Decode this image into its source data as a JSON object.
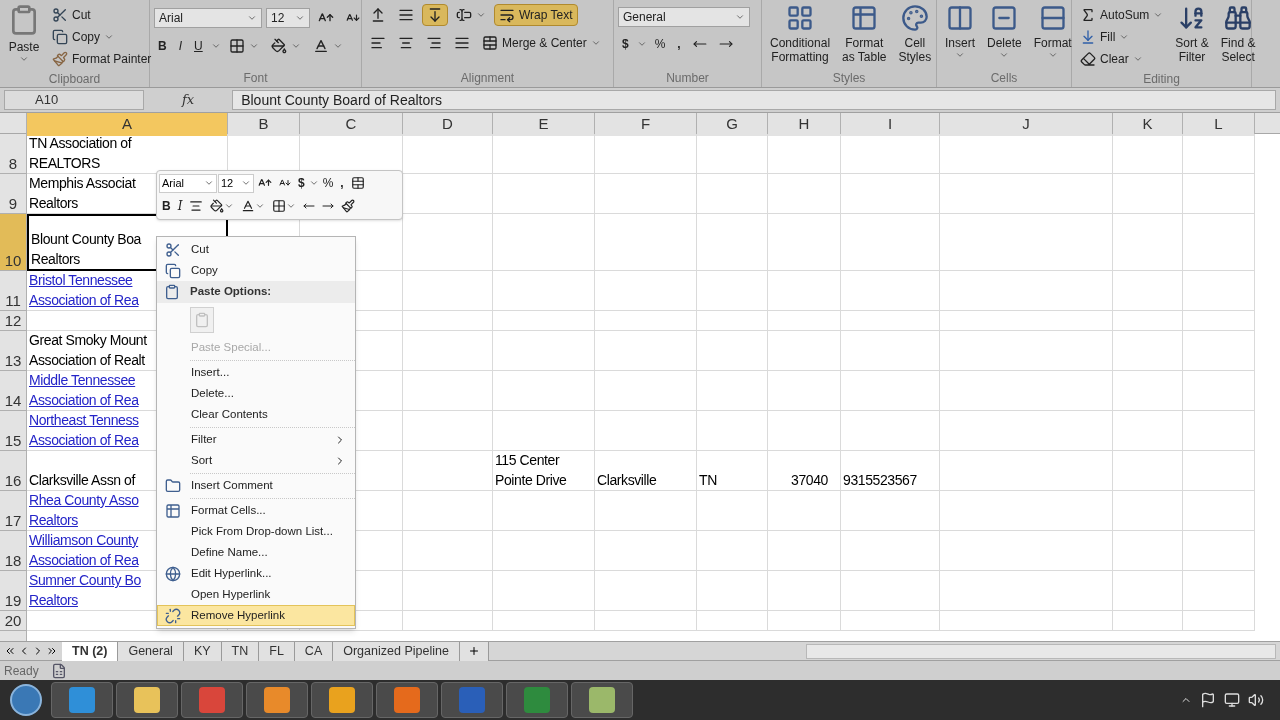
{
  "ribbon": {
    "clipboard": {
      "label": "Clipboard",
      "paste": "Paste",
      "cut": "Cut",
      "copy": "Copy",
      "format_painter": "Format Painter"
    },
    "font": {
      "label": "Font",
      "font_name": "Arial",
      "font_size": "12",
      "bold": "B",
      "italic": "I",
      "underline": "U"
    },
    "alignment": {
      "label": "Alignment",
      "bottom_align_on": true,
      "wrap_text": "Wrap Text",
      "wrap_text_on": true,
      "merge": "Merge & Center"
    },
    "number": {
      "label": "Number",
      "format": "General",
      "currency": "$",
      "percent": "%",
      "comma": ","
    },
    "styles": {
      "label": "Styles",
      "buttons": [
        "Conditional\nFormatting",
        "Format\nas Table",
        "Cell\nStyles"
      ]
    },
    "cells": {
      "label": "Cells",
      "buttons": [
        "Insert",
        "Delete",
        "Format"
      ]
    },
    "editing": {
      "label": "Editing",
      "autosum": "AutoSum",
      "fill": "Fill",
      "clear": "Clear",
      "buttons": [
        "Sort &\nFilter",
        "Find &\nSelect"
      ]
    }
  },
  "formula_bar": {
    "name_box": "A10",
    "fx": "fx",
    "value": "Blount County Board of Realtors"
  },
  "columns": [
    {
      "label": "A",
      "selected": true
    },
    {
      "label": "B",
      "selected": false
    },
    {
      "label": "C",
      "selected": false
    },
    {
      "label": "D",
      "selected": false
    },
    {
      "label": "E",
      "selected": false
    },
    {
      "label": "F",
      "selected": false
    },
    {
      "label": "G",
      "selected": false
    },
    {
      "label": "H",
      "selected": false
    },
    {
      "label": "I",
      "selected": false
    },
    {
      "label": "J",
      "selected": false
    },
    {
      "label": "K",
      "selected": false
    },
    {
      "label": "L",
      "selected": false
    }
  ],
  "rows": [
    {
      "header": "8",
      "selected": false,
      "cells": [
        {
          "kind": "text",
          "text": "TN Association of\nREALTORS"
        }
      ]
    },
    {
      "header": "9",
      "selected": false,
      "cells": [
        {
          "kind": "text",
          "text": "Memphis Associat\nRealtors"
        }
      ]
    },
    {
      "header": "10",
      "selected": true,
      "cells": [
        {
          "kind": "text",
          "text": "Blount County Boa\nRealtors"
        }
      ]
    },
    {
      "header": "11",
      "selected": false,
      "cells": [
        {
          "kind": "link",
          "text": "Bristol Tennessee\nAssociation of Rea"
        }
      ]
    },
    {
      "header": "12",
      "selected": false,
      "cells": []
    },
    {
      "header": "13",
      "selected": false,
      "cells": [
        {
          "kind": "text",
          "text": "Great Smoky Mount\nAssociation of Realt"
        }
      ]
    },
    {
      "header": "14",
      "selected": false,
      "cells": [
        {
          "kind": "link",
          "text": "Middle Tennessee\nAssociation of Rea"
        }
      ]
    },
    {
      "header": "15",
      "selected": false,
      "cells": [
        {
          "kind": "link",
          "text": "Northeast Tenness\nAssociation of Rea"
        }
      ]
    },
    {
      "header": "16",
      "selected": false,
      "cells": [
        {
          "kind": "text",
          "text": "Clarksville Assn of"
        },
        {},
        {},
        {},
        {
          "kind": "text",
          "text": "115 Center\nPointe Drive"
        },
        {
          "kind": "text",
          "text": "Clarksville"
        },
        {
          "kind": "text",
          "text": "TN"
        },
        {
          "kind": "number",
          "text": "37040"
        },
        {
          "kind": "text",
          "text": "9315523567"
        }
      ]
    },
    {
      "header": "17",
      "selected": false,
      "cells": [
        {
          "kind": "link",
          "text": "Rhea County Asso\nRealtors"
        }
      ]
    },
    {
      "header": "18",
      "selected": false,
      "cells": [
        {
          "kind": "link",
          "text": "Williamson County\nAssociation of Rea"
        }
      ]
    },
    {
      "header": "19",
      "selected": false,
      "cells": [
        {
          "kind": "link",
          "text": "Sumner County Bo\nRealtors"
        }
      ]
    },
    {
      "header": "20",
      "selected": false,
      "cells": []
    }
  ],
  "mini_toolbar": {
    "font_name": "Arial",
    "font_size": "12",
    "currency": "$",
    "percent": "%",
    "comma": ",",
    "bold": "B",
    "italic": "I"
  },
  "context_menu": [
    {
      "kind": "item",
      "label": "Cut",
      "disabled": false,
      "submenu": false,
      "selected": false
    },
    {
      "kind": "item",
      "label": "Copy",
      "disabled": false,
      "submenu": false,
      "selected": false
    },
    {
      "kind": "header",
      "label": "Paste Options:"
    },
    {
      "kind": "paste-icons"
    },
    {
      "kind": "item",
      "label": "Paste Special...",
      "disabled": true,
      "submenu": false,
      "selected": false
    },
    {
      "kind": "separator"
    },
    {
      "kind": "item",
      "label": "Insert...",
      "disabled": false,
      "submenu": false,
      "selected": false
    },
    {
      "kind": "item",
      "label": "Delete...",
      "disabled": false,
      "submenu": false,
      "selected": false
    },
    {
      "kind": "item",
      "label": "Clear Contents",
      "disabled": false,
      "submenu": false,
      "selected": false
    },
    {
      "kind": "separator"
    },
    {
      "kind": "item",
      "label": "Filter",
      "disabled": false,
      "submenu": true,
      "selected": false
    },
    {
      "kind": "item",
      "label": "Sort",
      "disabled": false,
      "submenu": true,
      "selected": false
    },
    {
      "kind": "separator"
    },
    {
      "kind": "item",
      "label": "Insert Comment",
      "disabled": false,
      "submenu": false,
      "selected": false
    },
    {
      "kind": "separator"
    },
    {
      "kind": "item",
      "label": "Format Cells...",
      "disabled": false,
      "submenu": false,
      "selected": false
    },
    {
      "kind": "item",
      "label": "Pick From Drop-down List...",
      "disabled": false,
      "submenu": false,
      "selected": false
    },
    {
      "kind": "item",
      "label": "Define Name...",
      "disabled": false,
      "submenu": false,
      "selected": false
    },
    {
      "kind": "item",
      "label": "Edit Hyperlink...",
      "disabled": false,
      "submenu": false,
      "selected": false
    },
    {
      "kind": "item",
      "label": "Open Hyperlink",
      "disabled": false,
      "submenu": false,
      "selected": false
    },
    {
      "kind": "item",
      "label": "Remove Hyperlink",
      "disabled": false,
      "submenu": false,
      "selected": true
    }
  ],
  "sheet_tabs": [
    {
      "label": "TN (2)",
      "selected": true
    },
    {
      "label": "General",
      "selected": false
    },
    {
      "label": "KY",
      "selected": false
    },
    {
      "label": "TN",
      "selected": false
    },
    {
      "label": "FL",
      "selected": false
    },
    {
      "label": "CA",
      "selected": false
    },
    {
      "label": "Organized Pipeline",
      "selected": false
    }
  ],
  "status_bar": {
    "text": "Ready"
  }
}
